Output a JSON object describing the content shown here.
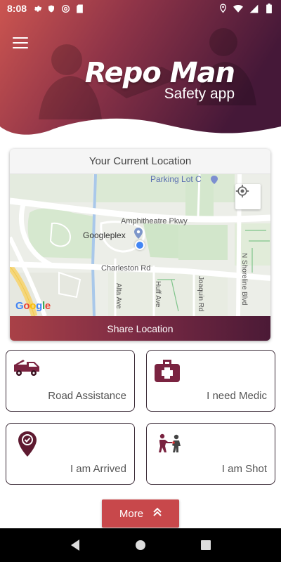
{
  "status_bar": {
    "time": "8:08",
    "icons": [
      "gear-icon",
      "shield-icon",
      "at-icon",
      "sd-card-icon"
    ],
    "right_icons": [
      "location-pin-icon",
      "wifi-icon",
      "signal-icon",
      "battery-icon"
    ]
  },
  "header": {
    "title": "Repo Man",
    "subtitle": "Safety app"
  },
  "location_card": {
    "title": "Your Current Location",
    "share_label": "Share Location",
    "map": {
      "labels": {
        "parking": "Parking Lot C",
        "amphitheatre": "Amphitheatre Pkwy",
        "googleplex": "Googleplex",
        "charleston": "Charleston Rd",
        "alta": "Alta Ave",
        "huff": "Huff Ave",
        "joaquin": "Joaquin Rd",
        "shoreline": "N Shoreline Blvd"
      },
      "google_logo": [
        "G",
        "o",
        "o",
        "g",
        "l",
        "e"
      ]
    }
  },
  "actions": [
    {
      "label": "Road Assistance",
      "icon": "tow-truck-icon"
    },
    {
      "label": "I need Medic",
      "icon": "first-aid-kit-icon"
    },
    {
      "label": "I am Arrived",
      "icon": "map-pin-check-icon"
    },
    {
      "label": "I am Shot",
      "icon": "shooter-icon"
    }
  ],
  "more_button": {
    "label": "More"
  },
  "nav_bar": {
    "icons": [
      "back-icon",
      "home-icon",
      "recents-icon"
    ]
  },
  "colors": {
    "header_start": "#c9504d",
    "header_end": "#4a1a3a",
    "accent": "#c8484b",
    "icon_dark": "#6e1f38"
  }
}
